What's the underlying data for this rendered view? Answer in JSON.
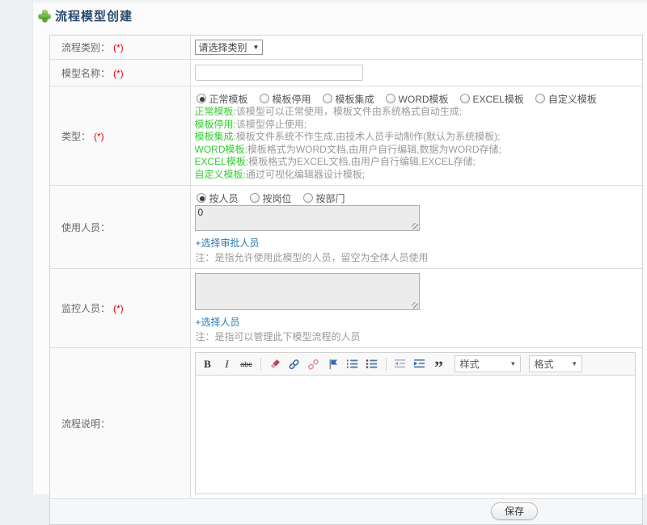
{
  "page": {
    "title": "流程模型创建"
  },
  "form": {
    "rows": {
      "category": {
        "label": "流程类别：",
        "required": "(*)",
        "select_value": "请选择类别"
      },
      "name": {
        "label": "模型名称：",
        "required": "(*)",
        "input_value": ""
      },
      "type": {
        "label": "类型：",
        "required": "(*)",
        "options": [
          "正常模板",
          "模板停用",
          "模板集成",
          "WORD模板",
          "EXCEL模板",
          "自定义模板"
        ],
        "selected": "正常模板",
        "descriptions": [
          {
            "term": "正常模板:",
            "text": "该模型可以正常使用，模板文件由系统格式自动生成;"
          },
          {
            "term": "模板停用:",
            "text": "该模型停止使用;"
          },
          {
            "term": "模板集成:",
            "text": "模板文件系统不作生成,由技术人员手动制作(默认为系统模板);"
          },
          {
            "term": "WORD模板:",
            "text": "模板格式为WORD文档,由用户自行编辑,数据为WORD存储;"
          },
          {
            "term": "EXCEL模板:",
            "text": "模板格式为EXCEL文档,由用户自行编辑,EXCEL存储;"
          },
          {
            "term": "自定义模板:",
            "text": "通过可视化编辑器设计模板;"
          }
        ]
      },
      "users": {
        "label": "使用人员：",
        "options": [
          "按人员",
          "按岗位",
          "按部门"
        ],
        "selected": "按人员",
        "textarea_value": "0",
        "link": "+选择审批人员",
        "note": "注：是指允许使用此模型的人员，留空为全体人员使用"
      },
      "monitors": {
        "label": "监控人员：",
        "required": "(*)",
        "textarea_value": "",
        "link": "+选择人员",
        "note": "注：是指可以管理此下模型流程的人员"
      },
      "description": {
        "label": "流程说明：",
        "editor": {
          "style_dropdown": "样式",
          "format_dropdown": "格式",
          "buttons": [
            "bold",
            "italic",
            "strikethrough",
            "remove-format",
            "link",
            "unlink",
            "anchor",
            "ordered-list",
            "bulleted-list",
            "outdent",
            "indent",
            "blockquote"
          ]
        }
      }
    },
    "save_label": "保存"
  },
  "colors": {
    "term_green": "#33cc33",
    "link_blue": "#2a7ab0",
    "required_red": "#e60000",
    "title_navy": "#2b4c6f"
  }
}
